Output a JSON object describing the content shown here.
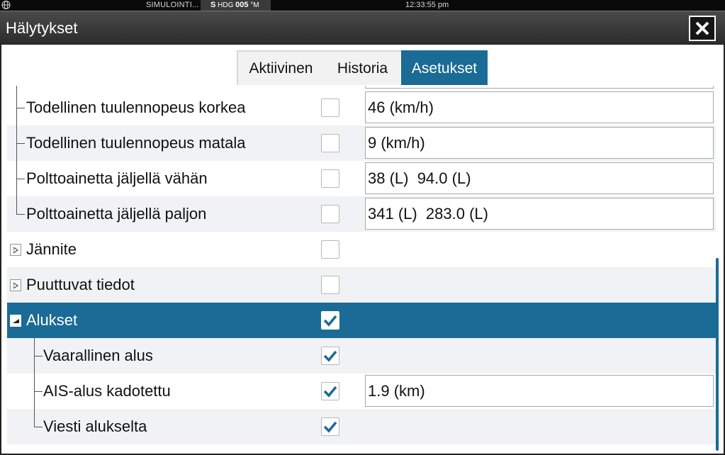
{
  "status": {
    "simulation": "SIMULOINTI...",
    "source": "S",
    "hdg_label": "HDG",
    "hdg_value": "005",
    "hdg_unit": "°M",
    "time": "12:33:55 pm"
  },
  "window": {
    "title": "Hälytykset"
  },
  "tabs": [
    {
      "label": "Aktiivinen"
    },
    {
      "label": "Historia"
    },
    {
      "label": "Asetukset"
    }
  ],
  "alarms": {
    "rows": [
      {
        "label": "Todellinen tuulennopeus korkea",
        "checked": false,
        "value": "46 (km/h)"
      },
      {
        "label": "Todellinen tuulennopeus matala",
        "checked": false,
        "value": "9 (km/h)"
      },
      {
        "label": "Polttoainetta jäljellä vähän",
        "checked": false,
        "value": "38 (L)  94.0 (L)"
      },
      {
        "label": "Polttoainetta jäljellä paljon",
        "checked": false,
        "value": "341 (L)  283.0 (L)"
      },
      {
        "label": "Jännite",
        "checked": false
      },
      {
        "label": "Puuttuvat tiedot",
        "checked": false
      },
      {
        "label": "Alukset",
        "checked": true,
        "selected": true
      },
      {
        "label": "Vaarallinen alus",
        "checked": true
      },
      {
        "label": "AIS-alus kadotettu",
        "checked": true,
        "value": "1.9 (km)"
      },
      {
        "label": "Viesti alukselta",
        "checked": true
      }
    ]
  },
  "colors": {
    "accent": "#1a6b95",
    "checkmark": "#1a6b95"
  }
}
